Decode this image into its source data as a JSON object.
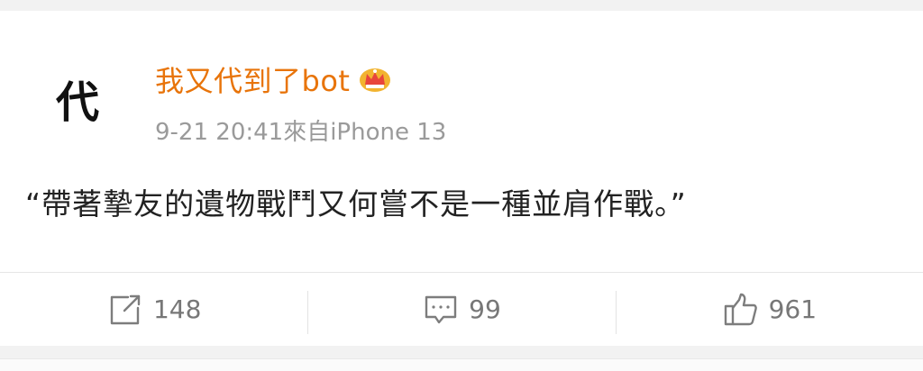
{
  "post": {
    "avatar_text": "代",
    "username": "我又代到了bot",
    "vip_badge_icon": "crown-badge-icon",
    "meta": "9-21 20:41來自iPhone 13",
    "content": "“帶著摯友的遺物戰鬥又何嘗不是一種並肩作戰。”"
  },
  "actions": {
    "repost": {
      "icon": "share-icon",
      "count": "148"
    },
    "comment": {
      "icon": "comment-icon",
      "count": "99"
    },
    "like": {
      "icon": "thumbs-up-icon",
      "count": "961"
    }
  },
  "colors": {
    "username": "#e8740a",
    "meta": "#9a9a9a",
    "content": "#222222",
    "action_icon": "#7d7d7d",
    "badge_gold": "#f2b430",
    "badge_red": "#e8453c"
  }
}
